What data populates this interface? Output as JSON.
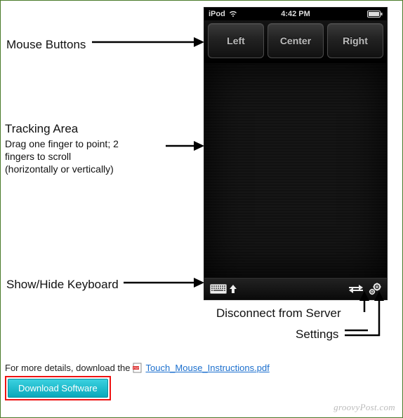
{
  "status_bar": {
    "carrier": "iPod",
    "time": "4:42 PM"
  },
  "mouse_buttons": {
    "left": "Left",
    "center": "Center",
    "right": "Right"
  },
  "labels": {
    "mouse_buttons": "Mouse Buttons",
    "tracking_title": "Tracking Area",
    "tracking_sub1": "Drag one finger to point; 2",
    "tracking_sub2": "fingers to scroll",
    "tracking_sub3": "(horizontally or vertically)",
    "show_hide_kb": "Show/Hide Keyboard",
    "disconnect": "Disconnect from Server",
    "settings": "Settings"
  },
  "details": {
    "prefix": "For more details, download the",
    "link_text": "Touch_Mouse_Instructions.pdf"
  },
  "download_button": "Download Software",
  "watermark": "groovyPost.com"
}
